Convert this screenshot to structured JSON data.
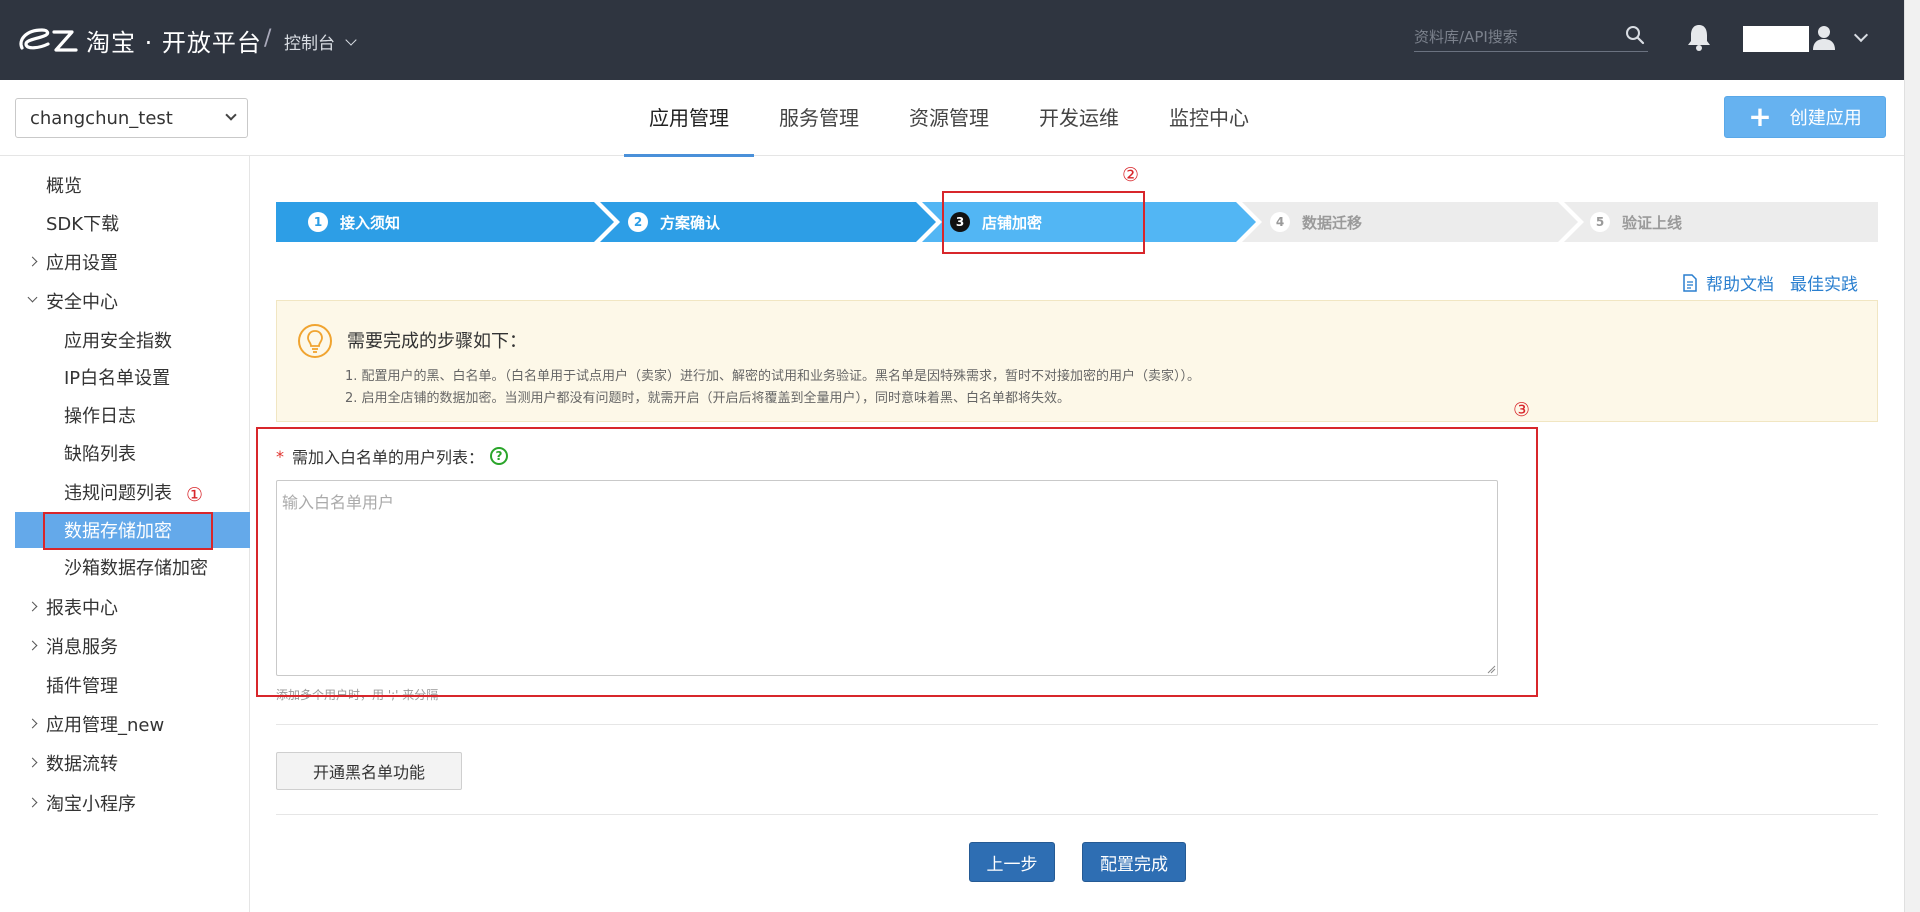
{
  "header": {
    "brand": "淘宝 · 开放平台",
    "separator": "/",
    "console_label": "控制台",
    "search_placeholder": "资料库/API搜索"
  },
  "subbar": {
    "app_selected": "changchun_test",
    "nav": [
      "应用管理",
      "服务管理",
      "资源管理",
      "开发运维",
      "监控中心"
    ],
    "active_nav": "应用管理",
    "create_button": "创建应用"
  },
  "sidebar": {
    "items": [
      {
        "label": "概览",
        "level": 1,
        "arrow": "none"
      },
      {
        "label": "SDK下载",
        "level": 1,
        "arrow": "none"
      },
      {
        "label": "应用设置",
        "level": 1,
        "arrow": "right"
      },
      {
        "label": "安全中心",
        "level": 1,
        "arrow": "down"
      },
      {
        "label": "应用安全指数",
        "level": 2,
        "arrow": "none"
      },
      {
        "label": "IP白名单设置",
        "level": 2,
        "arrow": "none"
      },
      {
        "label": "操作日志",
        "level": 2,
        "arrow": "none"
      },
      {
        "label": "缺陷列表",
        "level": 2,
        "arrow": "none"
      },
      {
        "label": "违规问题列表",
        "level": 2,
        "arrow": "none"
      },
      {
        "label": "数据存储加密",
        "level": 2,
        "arrow": "none",
        "selected": true
      },
      {
        "label": "沙箱数据存储加密",
        "level": 2,
        "arrow": "none"
      },
      {
        "label": "报表中心",
        "level": 1,
        "arrow": "right"
      },
      {
        "label": "消息服务",
        "level": 1,
        "arrow": "right"
      },
      {
        "label": "插件管理",
        "level": 1,
        "arrow": "none"
      },
      {
        "label": "应用管理_new",
        "level": 1,
        "arrow": "right"
      },
      {
        "label": "数据流转",
        "level": 1,
        "arrow": "right"
      },
      {
        "label": "淘宝小程序",
        "level": 1,
        "arrow": "right"
      }
    ]
  },
  "steps": [
    {
      "num": "1",
      "label": "接入须知",
      "state": "done"
    },
    {
      "num": "2",
      "label": "方案确认",
      "state": "done"
    },
    {
      "num": "3",
      "label": "店铺加密",
      "state": "current"
    },
    {
      "num": "4",
      "label": "数据迁移",
      "state": "todo"
    },
    {
      "num": "5",
      "label": "验证上线",
      "state": "todo"
    }
  ],
  "help_links": {
    "doc": "帮助文档",
    "practice": "最佳实践"
  },
  "notice": {
    "title": "需要完成的步骤如下：",
    "lines": [
      "1. 配置用户的黑、白名单。（白名单用于试点用户（卖家）进行加、解密的试用和业务验证。黑名单是因特殊需求，暂时不对接加密的用户（卖家））。",
      "2. 启用全店铺的数据加密。当测用户都没有问题时，就需开启（开启后将覆盖到全量用户），同时意味着黑、白名单都将失效。"
    ]
  },
  "form": {
    "required_mark": "*",
    "label": "需加入白名单的用户列表：",
    "help_glyph": "?",
    "placeholder": "输入白名单用户",
    "hint": "添加多个用户时，用 ';' 来分隔"
  },
  "buttons": {
    "blacklist": "开通黑名单功能",
    "prev": "上一步",
    "finish": "配置完成"
  },
  "annotations": [
    "①",
    "②",
    "③"
  ],
  "colors": {
    "topbar": "#2f3540",
    "step_done": "#2d9ee6",
    "step_current": "#52b6f4",
    "step_todo": "#ececec",
    "annotation": "#d8262b",
    "primary_button": "#2e6eb3"
  }
}
